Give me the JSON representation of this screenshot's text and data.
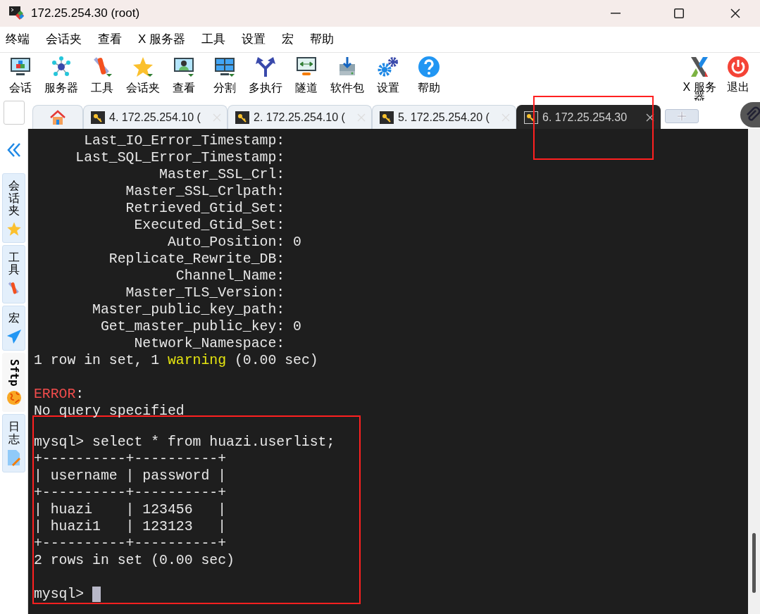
{
  "window": {
    "title": "172.25.254.30 (root)"
  },
  "menu": [
    "终端",
    "会话夹",
    "查看",
    "X 服务器",
    "工具",
    "设置",
    "宏",
    "帮助"
  ],
  "toolbar": [
    {
      "kind": "session",
      "label": "会话"
    },
    {
      "kind": "servers",
      "label": "服务器"
    },
    {
      "kind": "tools",
      "label": "工具"
    },
    {
      "kind": "favorites",
      "label": "会话夹"
    },
    {
      "kind": "view",
      "label": "查看"
    },
    {
      "kind": "split",
      "label": "分割"
    },
    {
      "kind": "multiexec",
      "label": "多执行"
    },
    {
      "kind": "tunnel",
      "label": "隧道"
    },
    {
      "kind": "packages",
      "label": "软件包"
    },
    {
      "kind": "settings",
      "label": "设置"
    },
    {
      "kind": "help",
      "label": "帮助"
    }
  ],
  "toolbar_right": [
    {
      "kind": "xserver",
      "label": "X 服务器"
    },
    {
      "kind": "exit",
      "label": "退出"
    }
  ],
  "tabs": [
    {
      "kind": "home",
      "selected": false,
      "highlighted": false
    },
    {
      "kind": "session",
      "label": "4. 172.25.254.10 (",
      "selected": false,
      "highlighted": false
    },
    {
      "kind": "session",
      "label": "2. 172.25.254.10 (",
      "selected": false,
      "highlighted": false
    },
    {
      "kind": "session",
      "label": "5. 172.25.254.20 (",
      "selected": false,
      "highlighted": false
    },
    {
      "kind": "session",
      "label": "6. 172.25.254.30",
      "selected": true,
      "highlighted": true
    }
  ],
  "sidebar": [
    {
      "kind": "favorites",
      "label": "会话夹",
      "selected": false
    },
    {
      "kind": "tools",
      "label": "工具",
      "selected": false
    },
    {
      "kind": "macros",
      "label": "宏",
      "selected": false
    },
    {
      "kind": "sftp",
      "label": "Sftp",
      "selected": true
    },
    {
      "kind": "log",
      "label": "日志",
      "selected": false
    }
  ],
  "terminal": {
    "blocks": [
      {
        "highlighted": false,
        "lines": [
          {
            "kind": "text",
            "spans": [
              {
                "kind": "normal",
                "text": "      Last_IO_Error_Timestamp:"
              }
            ]
          },
          {
            "kind": "text",
            "spans": [
              {
                "kind": "normal",
                "text": "     Last_SQL_Error_Timestamp:"
              }
            ]
          },
          {
            "kind": "text",
            "spans": [
              {
                "kind": "normal",
                "text": "               Master_SSL_Crl:"
              }
            ]
          },
          {
            "kind": "text",
            "spans": [
              {
                "kind": "normal",
                "text": "           Master_SSL_Crlpath:"
              }
            ]
          },
          {
            "kind": "text",
            "spans": [
              {
                "kind": "normal",
                "text": "           Retrieved_Gtid_Set:"
              }
            ]
          },
          {
            "kind": "text",
            "spans": [
              {
                "kind": "normal",
                "text": "            Executed_Gtid_Set:"
              }
            ]
          },
          {
            "kind": "text",
            "spans": [
              {
                "kind": "normal",
                "text": "                Auto_Position: 0"
              }
            ]
          },
          {
            "kind": "text",
            "spans": [
              {
                "kind": "normal",
                "text": "         Replicate_Rewrite_DB:"
              }
            ]
          },
          {
            "kind": "text",
            "spans": [
              {
                "kind": "normal",
                "text": "                 Channel_Name:"
              }
            ]
          },
          {
            "kind": "text",
            "spans": [
              {
                "kind": "normal",
                "text": "           Master_TLS_Version:"
              }
            ]
          },
          {
            "kind": "text",
            "spans": [
              {
                "kind": "normal",
                "text": "       Master_public_key_path:"
              }
            ]
          },
          {
            "kind": "text",
            "spans": [
              {
                "kind": "normal",
                "text": "        Get_master_public_key: 0"
              }
            ]
          },
          {
            "kind": "text",
            "spans": [
              {
                "kind": "normal",
                "text": "            Network_Namespace:"
              }
            ]
          },
          {
            "kind": "text",
            "spans": [
              {
                "kind": "normal",
                "text": "1 row in set, 1 "
              },
              {
                "kind": "warning",
                "text": "warning"
              },
              {
                "kind": "normal",
                "text": " (0.00 sec)"
              }
            ]
          },
          {
            "kind": "blank"
          },
          {
            "kind": "text",
            "spans": [
              {
                "kind": "error",
                "text": "ERROR"
              },
              {
                "kind": "normal",
                "text": ":"
              }
            ]
          },
          {
            "kind": "text",
            "spans": [
              {
                "kind": "normal",
                "text": "No query specified"
              }
            ]
          }
        ]
      },
      {
        "highlighted": true,
        "lines": [
          {
            "kind": "blank"
          },
          {
            "kind": "text",
            "spans": [
              {
                "kind": "normal",
                "text": "mysql> select * from huazi.userlist;"
              }
            ]
          },
          {
            "kind": "text",
            "spans": [
              {
                "kind": "normal",
                "text": "+----------+----------+"
              }
            ]
          },
          {
            "kind": "text",
            "spans": [
              {
                "kind": "normal",
                "text": "| username | password |"
              }
            ]
          },
          {
            "kind": "text",
            "spans": [
              {
                "kind": "normal",
                "text": "+----------+----------+"
              }
            ]
          },
          {
            "kind": "text",
            "spans": [
              {
                "kind": "normal",
                "text": "| huazi    | 123456   |"
              }
            ]
          },
          {
            "kind": "text",
            "spans": [
              {
                "kind": "normal",
                "text": "| huazi1   | 123123   |"
              }
            ]
          },
          {
            "kind": "text",
            "spans": [
              {
                "kind": "normal",
                "text": "+----------+----------+"
              }
            ]
          },
          {
            "kind": "text",
            "spans": [
              {
                "kind": "normal",
                "text": "2 rows in set (0.00 sec)"
              }
            ]
          },
          {
            "kind": "blank"
          },
          {
            "kind": "text",
            "spans": [
              {
                "kind": "normal",
                "text": "mysql> "
              }
            ],
            "cursor": true
          }
        ]
      }
    ]
  }
}
